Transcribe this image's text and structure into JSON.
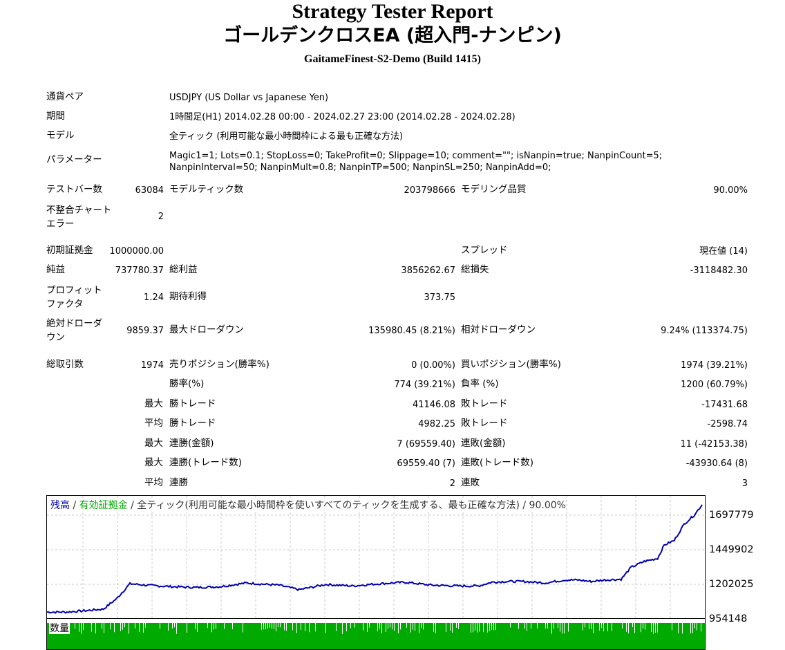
{
  "header": {
    "title": "Strategy Tester Report",
    "ea_name": "ゴールデンクロスEA (超入門-ナンピン)",
    "server": "GaitameFinest-S2-Demo (Build 1415)"
  },
  "settings": {
    "symbol_label": "通貨ペア",
    "symbol_value": "USDJPY (US Dollar vs Japanese Yen)",
    "period_label": "期間",
    "period_value": "1時間足(H1) 2014.02.28 00:00 - 2024.02.27 23:00 (2014.02.28 - 2024.02.28)",
    "model_label": "モデル",
    "model_value": "全ティック (利用可能な最小時間枠による最も正確な方法)",
    "params_label": "パラメーター",
    "params_value": "Magic1=1; Lots=0.1; StopLoss=0; TakeProfit=0; Slippage=10; comment=\"\"; isNanpin=true; NanpinCount=5; NanpinInterval=50; NanpinMult=0.8; NanpinTP=500; NanpinSL=250; NanpinAdd=0;"
  },
  "stats": {
    "bars_label": "テストバー数",
    "bars_value": "63084",
    "ticks_label": "モデルティック数",
    "ticks_value": "203798666",
    "quality_label": "モデリング品質",
    "quality_value": "90.00%",
    "mismatch_label": "不整合チャートエラー",
    "mismatch_value": "2",
    "deposit_label": "初期証拠金",
    "deposit_value": "1000000.00",
    "spread_label": "スプレッド",
    "spread_value": "現在値 (14)",
    "net_label": "純益",
    "net_value": "737780.37",
    "gross_profit_label": "総利益",
    "gross_profit_value": "3856262.67",
    "gross_loss_label": "総損失",
    "gross_loss_value": "-3118482.30",
    "pf_label": "プロフィットファクタ",
    "pf_value": "1.24",
    "payoff_label": "期待利得",
    "payoff_value": "373.75",
    "abs_dd_label": "絶対ドローダウン",
    "abs_dd_value": "9859.37",
    "max_dd_label": "最大ドローダウン",
    "max_dd_value": "135980.45 (8.21%)",
    "rel_dd_label": "相対ドローダウン",
    "rel_dd_value": "9.24% (113374.75)",
    "trades_label": "総取引数",
    "trades_value": "1974",
    "short_label": "売りポジション(勝率%)",
    "short_value": "0 (0.00%)",
    "long_label": "買いポジション(勝率%)",
    "long_value": "1974 (39.21%)",
    "win_label": "勝率(%)",
    "win_value": "774 (39.21%)",
    "loss_label": "負率 (%)",
    "loss_value": "1200 (60.79%)",
    "max_word": "最大",
    "avg_word": "平均",
    "largest_win_label": "勝トレード",
    "largest_win_value": "41146.08",
    "largest_loss_label": "敗トレード",
    "largest_loss_value": "-17431.68",
    "avg_win_label": "勝トレード",
    "avg_win_value": "4982.25",
    "avg_loss_label": "敗トレード",
    "avg_loss_value": "-2598.74",
    "max_consec_win_label": "連勝(金額)",
    "max_consec_win_value": "7 (69559.40)",
    "max_consec_loss_label": "連敗(金額)",
    "max_consec_loss_value": "11 (-42153.38)",
    "max_consec_profit_label": "連勝(トレード数)",
    "max_consec_profit_value": "69559.40 (7)",
    "max_consec_lossamt_label": "連敗(トレード数)",
    "max_consec_lossamt_value": "-43930.64 (8)",
    "avg_consec_win_label": "連勝",
    "avg_consec_win_value": "2",
    "avg_consec_loss_label": "連敗",
    "avg_consec_loss_value": "3"
  },
  "chart_data": {
    "type": "line",
    "legend": {
      "balance": "残高",
      "sep1": " / ",
      "equity": "有効証拠金",
      "rest": " / 全ティック(利用可能な最小時間枠を使いすべてのティックを生成する、最も正確な方法) / 90.00%"
    },
    "colors": {
      "balance": "#0000aa",
      "equity": "#00aa00",
      "grid": "#c8c8c8"
    },
    "y_tick_labels": [
      "1697779",
      "1449902",
      "1202025",
      "954148"
    ],
    "ylim": [
      954148,
      1780000
    ],
    "xlim": [
      0,
      1974
    ],
    "grid": true,
    "series": [
      {
        "key": "balance",
        "values": [
          [
            0,
            1000000
          ],
          [
            60,
            1000000
          ],
          [
            120,
            1010000
          ],
          [
            170,
            1020000
          ],
          [
            210,
            1090000
          ],
          [
            250,
            1190000
          ],
          [
            300,
            1180000
          ],
          [
            380,
            1170000
          ],
          [
            450,
            1165000
          ],
          [
            520,
            1170000
          ],
          [
            600,
            1195000
          ],
          [
            700,
            1180000
          ],
          [
            760,
            1150000
          ],
          [
            840,
            1185000
          ],
          [
            920,
            1175000
          ],
          [
            1000,
            1190000
          ],
          [
            1080,
            1200000
          ],
          [
            1160,
            1180000
          ],
          [
            1240,
            1175000
          ],
          [
            1300,
            1175000
          ],
          [
            1340,
            1200000
          ],
          [
            1380,
            1205000
          ],
          [
            1440,
            1205000
          ],
          [
            1500,
            1195000
          ],
          [
            1560,
            1215000
          ],
          [
            1600,
            1215000
          ],
          [
            1640,
            1205000
          ],
          [
            1680,
            1215000
          ],
          [
            1730,
            1220000
          ],
          [
            1760,
            1300000
          ],
          [
            1800,
            1340000
          ],
          [
            1840,
            1360000
          ],
          [
            1860,
            1450000
          ],
          [
            1890,
            1480000
          ],
          [
            1920,
            1590000
          ],
          [
            1950,
            1650000
          ],
          [
            1974,
            1720000
          ]
        ]
      }
    ],
    "volume_label": "数量"
  }
}
